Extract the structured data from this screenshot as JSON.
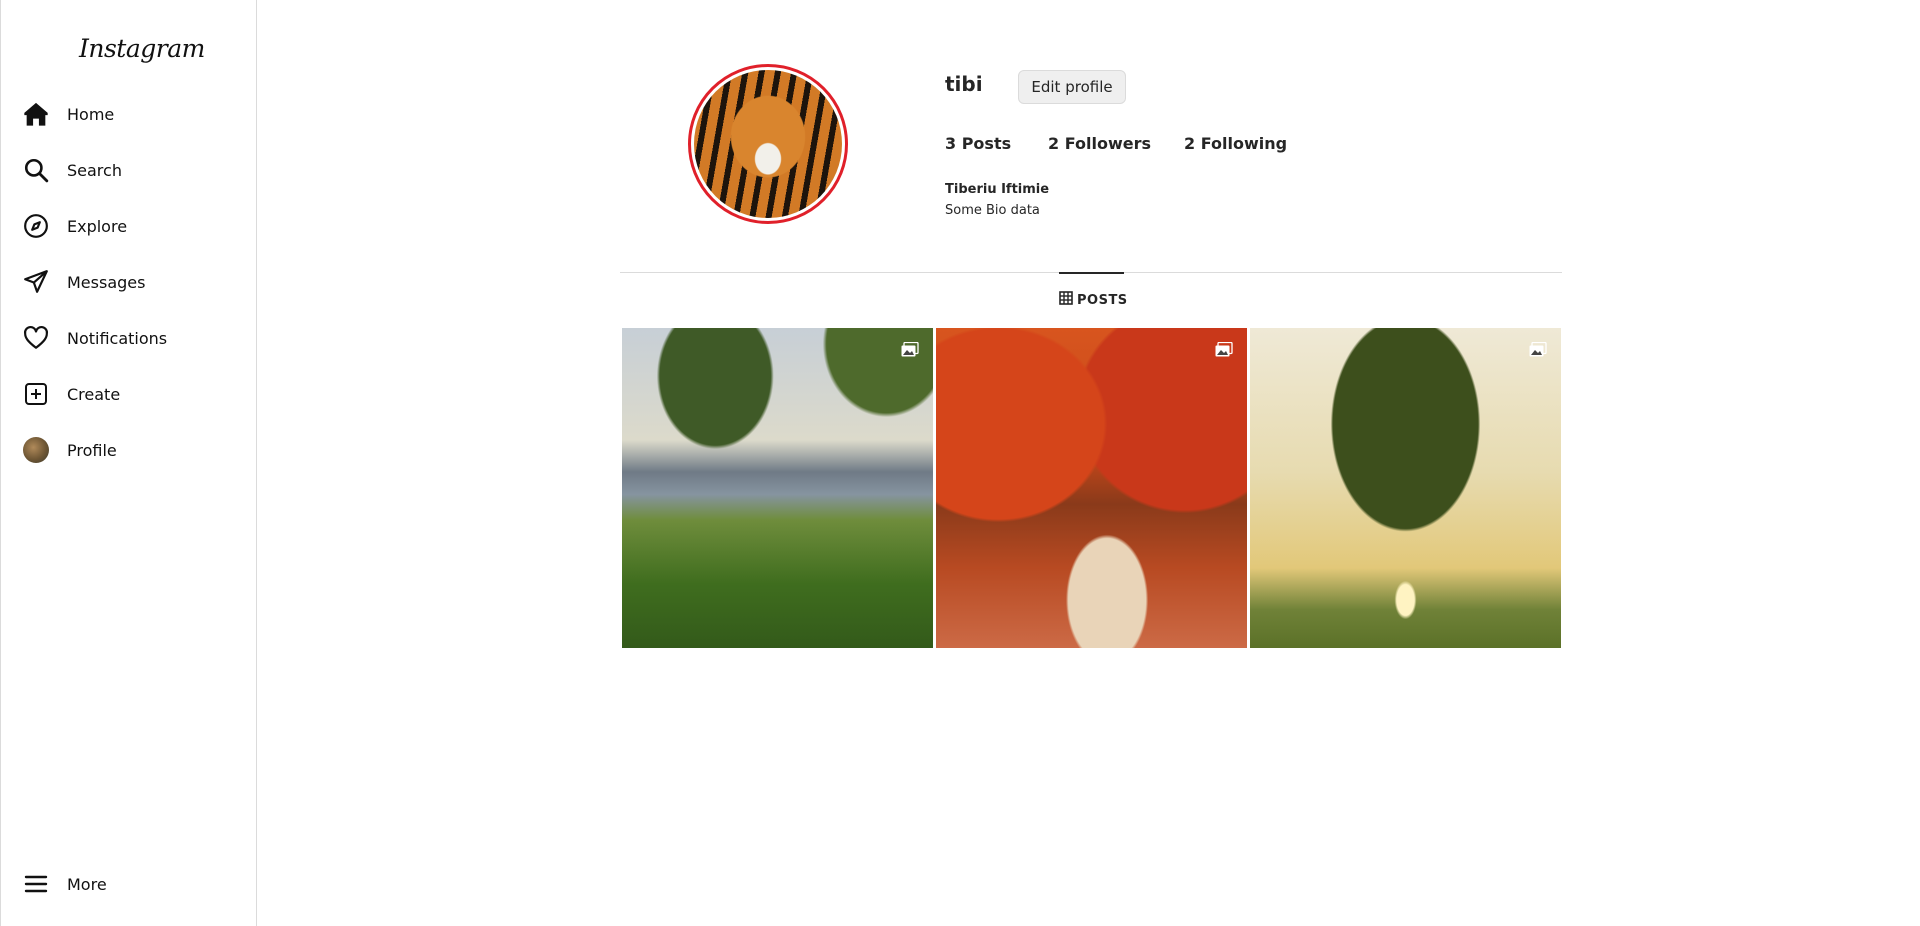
{
  "app": {
    "logo_text": "Instagram"
  },
  "sidebar": {
    "items": [
      {
        "label": "Home",
        "icon": "home-icon"
      },
      {
        "label": "Search",
        "icon": "search-icon"
      },
      {
        "label": "Explore",
        "icon": "compass-icon"
      },
      {
        "label": "Messages",
        "icon": "paper-plane-icon"
      },
      {
        "label": "Notifications",
        "icon": "heart-icon"
      },
      {
        "label": "Create",
        "icon": "plus-square-icon"
      },
      {
        "label": "Profile",
        "icon": "avatar"
      }
    ],
    "more": {
      "label": "More",
      "icon": "menu-icon"
    }
  },
  "profile": {
    "username": "tibi",
    "edit_button": "Edit profile",
    "stats": {
      "posts": "3 Posts",
      "followers": "2 Followers",
      "following": "2 Following"
    },
    "full_name": "Tiberiu Iftimie",
    "bio": "Some Bio data",
    "avatar_ring_color": "#e0202a"
  },
  "tabs": {
    "posts_label": "POSTS"
  },
  "posts": [
    {
      "overlay_icon": "image-icon"
    },
    {
      "overlay_icon": "image-icon"
    },
    {
      "overlay_icon": "image-icon"
    }
  ]
}
